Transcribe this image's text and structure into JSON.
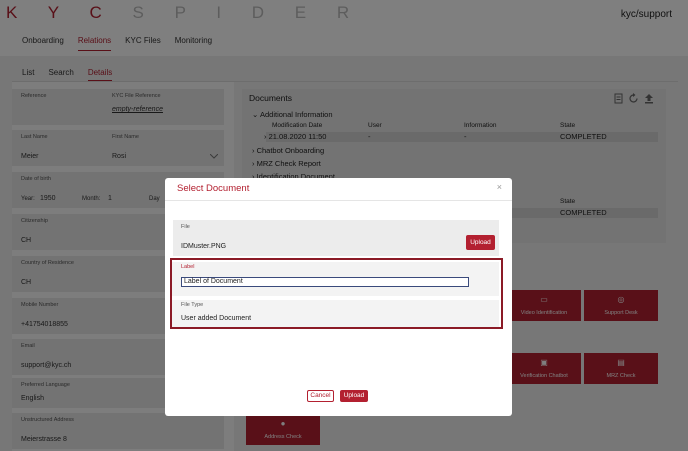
{
  "header": {
    "logo_left": "K Y C",
    "logo_right": "S P I D E R",
    "user": "kyc/support"
  },
  "nav": [
    "Onboarding",
    "Relations",
    "KYC Files",
    "Monitoring"
  ],
  "subnav": [
    "List",
    "Search",
    "Details"
  ],
  "form": {
    "reference_label": "Reference",
    "kyc_ref_label": "KYC File Reference",
    "kyc_ref_value": "empty-reference",
    "lastname_label": "Last Name",
    "lastname_value": "Meier",
    "firstname_label": "First Name",
    "firstname_value": "Rosi",
    "dob_label": "Date of birth",
    "year_label": "Year:",
    "year_value": "1950",
    "month_label": "Month:",
    "month_value": "1",
    "day_label": "Day",
    "citizenship_label": "Citizenship",
    "citizenship_value": "CH",
    "residence_label": "Country of Residence",
    "residence_value": "CH",
    "mobile_label": "Mobile Number",
    "mobile_value": "+41754018855",
    "email_label": "Email",
    "email_value": "support@kyc.ch",
    "language_label": "Preferred Language",
    "language_value": "English",
    "address_label": "Unstructured Address",
    "address_value": "Meierstrasse 8"
  },
  "documents": {
    "title": "Documents",
    "additional": "Additional Information",
    "col_mod": "Modification Date",
    "col_user": "User",
    "col_info": "Information",
    "col_state": "State",
    "row1_date": "21.08.2020 11:50",
    "row1_user": "-",
    "row1_info": "-",
    "row1_state": "COMPLETED",
    "chatbot": "Chatbot Onboarding",
    "mrz": "MRZ Check Report",
    "identification": "Identification Document",
    "state2": "State",
    "state2_value": "COMPLETED"
  },
  "tiles": [
    "Video Identification",
    "Support Desk",
    "Verification Chatbot",
    "MRZ Check",
    "Address Check"
  ],
  "modal": {
    "title": "Select Document",
    "close": "×",
    "file_label": "File",
    "file_value": "IDMuster.PNG",
    "upload_small": "Upload",
    "label_label": "Label",
    "label_value": "Label of Document",
    "type_label": "File Type",
    "type_value": "User added Document",
    "cancel": "Cancel",
    "upload": "Upload"
  }
}
